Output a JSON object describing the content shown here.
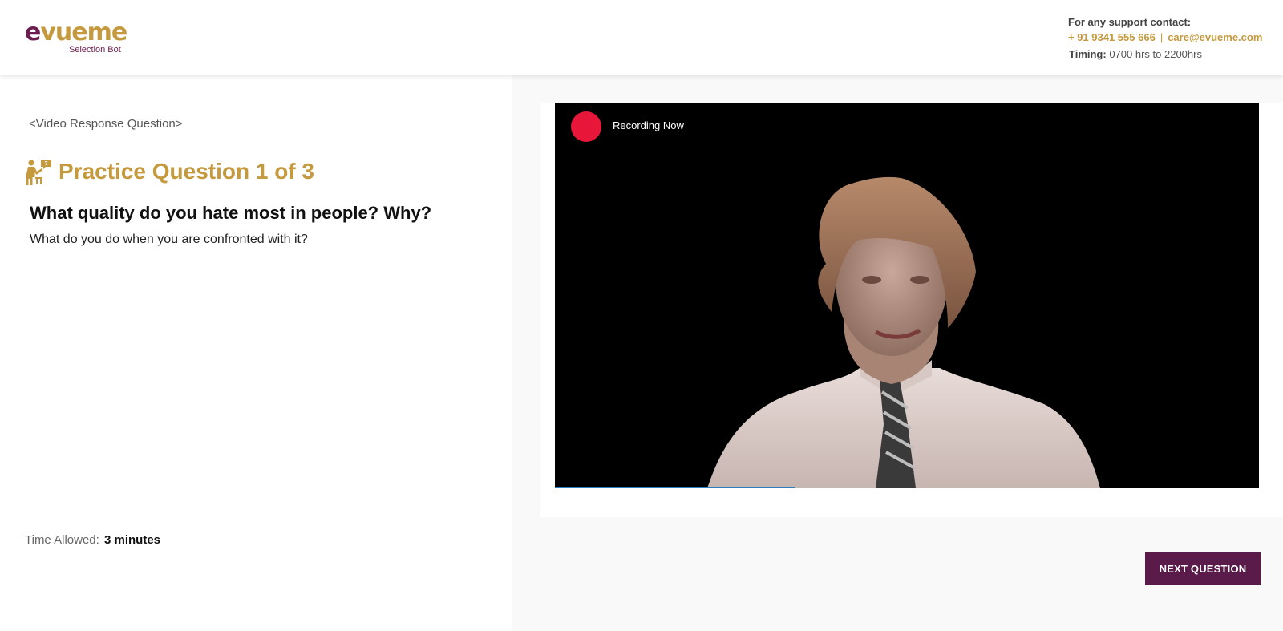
{
  "brand": {
    "logo_first": "e",
    "logo_rest": "vueme",
    "logo_sub": "Selection Bot",
    "colors": {
      "gold": "#c59a3e",
      "plum": "#6b1d4f",
      "button": "#5a1a4a",
      "record": "#e8173a"
    }
  },
  "support": {
    "label": "For any support contact:",
    "phone": "+ 91 9341 555 666",
    "separator": "|",
    "email": "care@evueme.com",
    "timing_label": "Timing:",
    "timing_value": "0700 hrs to  2200hrs"
  },
  "question": {
    "type_label": "<Video Response Question>",
    "icon": "teacher-icon",
    "practice_title": "Practice Question 1 of 3",
    "main": "What quality do you hate most in people? Why?",
    "sub": "What do you do when you are confronted with it?",
    "time_label": "Time Allowed:",
    "time_value": "3 minutes"
  },
  "video": {
    "recording_label": "Recording Now",
    "progress": 0.34
  },
  "actions": {
    "next_label": "NEXT QUESTION"
  }
}
